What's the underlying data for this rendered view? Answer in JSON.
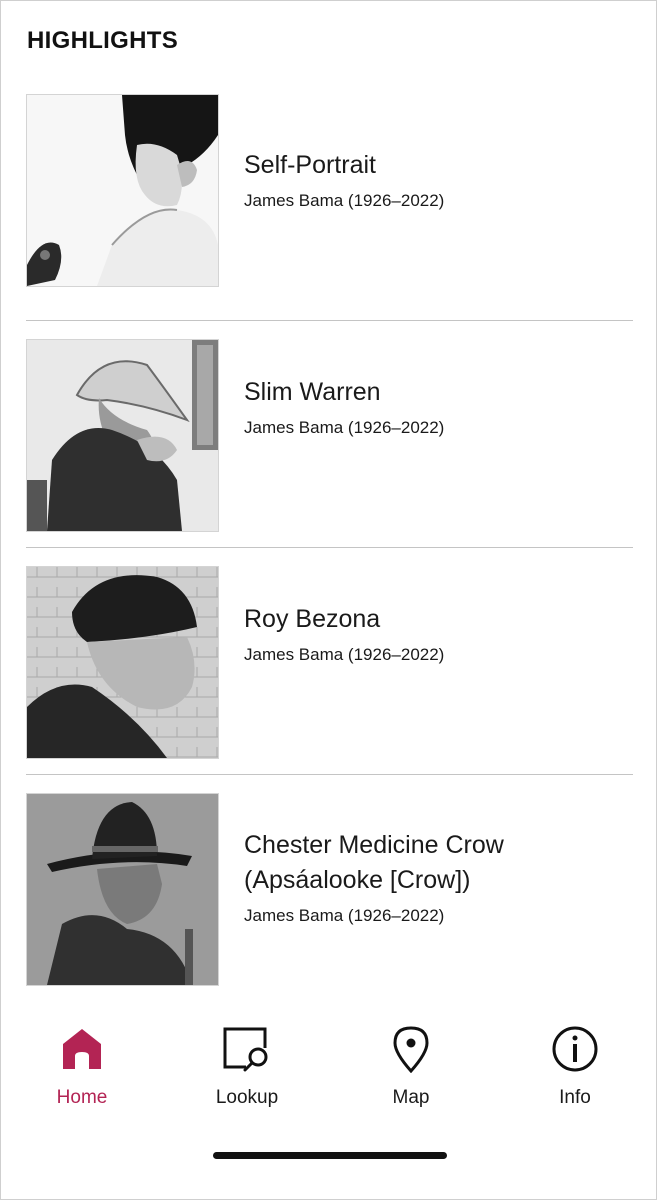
{
  "section": {
    "title": "HIGHLIGHTS"
  },
  "items": [
    {
      "title": "Self-Portrait",
      "artist": "James Bama (1926–2022)"
    },
    {
      "title": "Slim Warren",
      "artist": "James Bama (1926–2022)"
    },
    {
      "title": "Roy Bezona",
      "artist": "James Bama (1926–2022)"
    },
    {
      "title_line1": "Chester Medicine Crow",
      "title_line2": "(Apsáalooke [Crow])",
      "artist": "James Bama (1926–2022)"
    }
  ],
  "nav": {
    "tabs": [
      {
        "label": "Home",
        "icon": "home-icon",
        "active": true
      },
      {
        "label": "Lookup",
        "icon": "lookup-icon",
        "active": false
      },
      {
        "label": "Map",
        "icon": "map-pin-icon",
        "active": false
      },
      {
        "label": "Info",
        "icon": "info-icon",
        "active": false
      }
    ]
  },
  "colors": {
    "accent": "#b32454",
    "text": "#111111",
    "divider": "#c4c4c4"
  }
}
